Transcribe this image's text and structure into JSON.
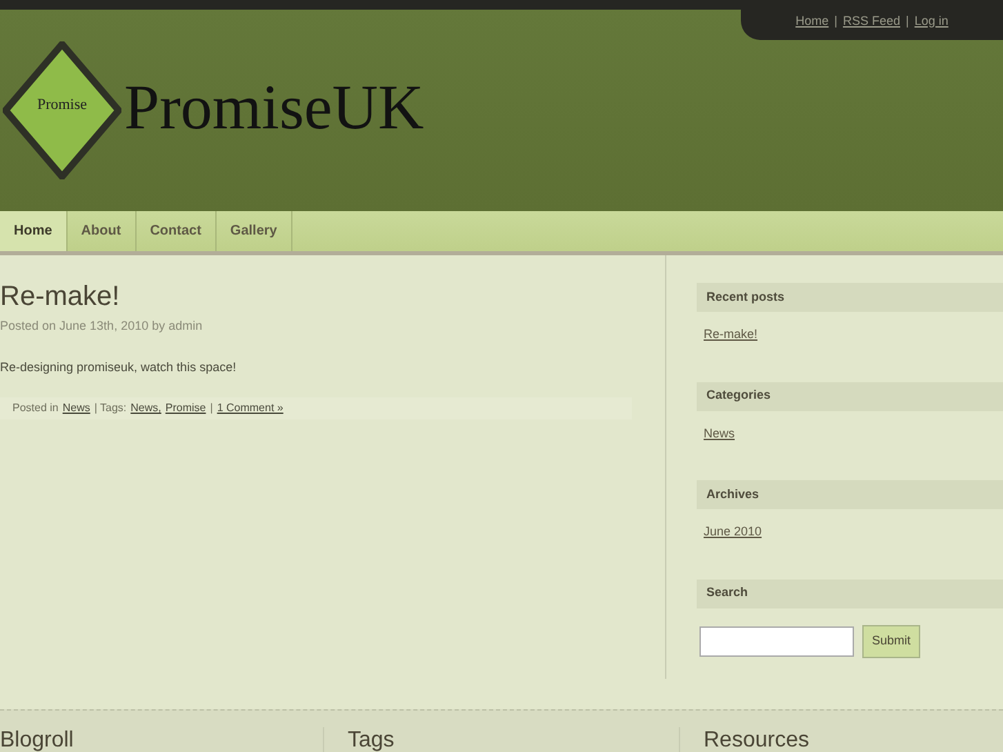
{
  "top_links": [
    "Home",
    "RSS Feed",
    "Log in"
  ],
  "top_link_separators": [
    "|",
    "|"
  ],
  "logo": {
    "emblem_text": "Promise",
    "site_title": "PromiseUK"
  },
  "nav": [
    {
      "label": "Home",
      "selected": true
    },
    {
      "label": "About",
      "selected": false
    },
    {
      "label": "Contact",
      "selected": false
    },
    {
      "label": "Gallery",
      "selected": false
    }
  ],
  "post": {
    "title": "Re-make!",
    "meta": "Posted on June 13th, 2010 by admin",
    "body": "Re-designing promiseuk, watch this space!",
    "footer": {
      "posted_in_label": "Posted in",
      "category": "News",
      "tags_label": "| Tags:",
      "tags": [
        "News,",
        "Promise"
      ],
      "separator": "|",
      "comments": "1 Comment »"
    }
  },
  "sidebar": [
    {
      "heading": "Recent posts",
      "links": [
        "Re-make!"
      ]
    },
    {
      "heading": "Categories",
      "links": [
        "News"
      ]
    },
    {
      "heading": "Archives",
      "links": [
        "June 2010"
      ]
    },
    {
      "heading": "Search",
      "search": {
        "button": "Submit"
      }
    }
  ],
  "footer_columns": [
    "Blogroll",
    "Tags",
    "Resources"
  ]
}
